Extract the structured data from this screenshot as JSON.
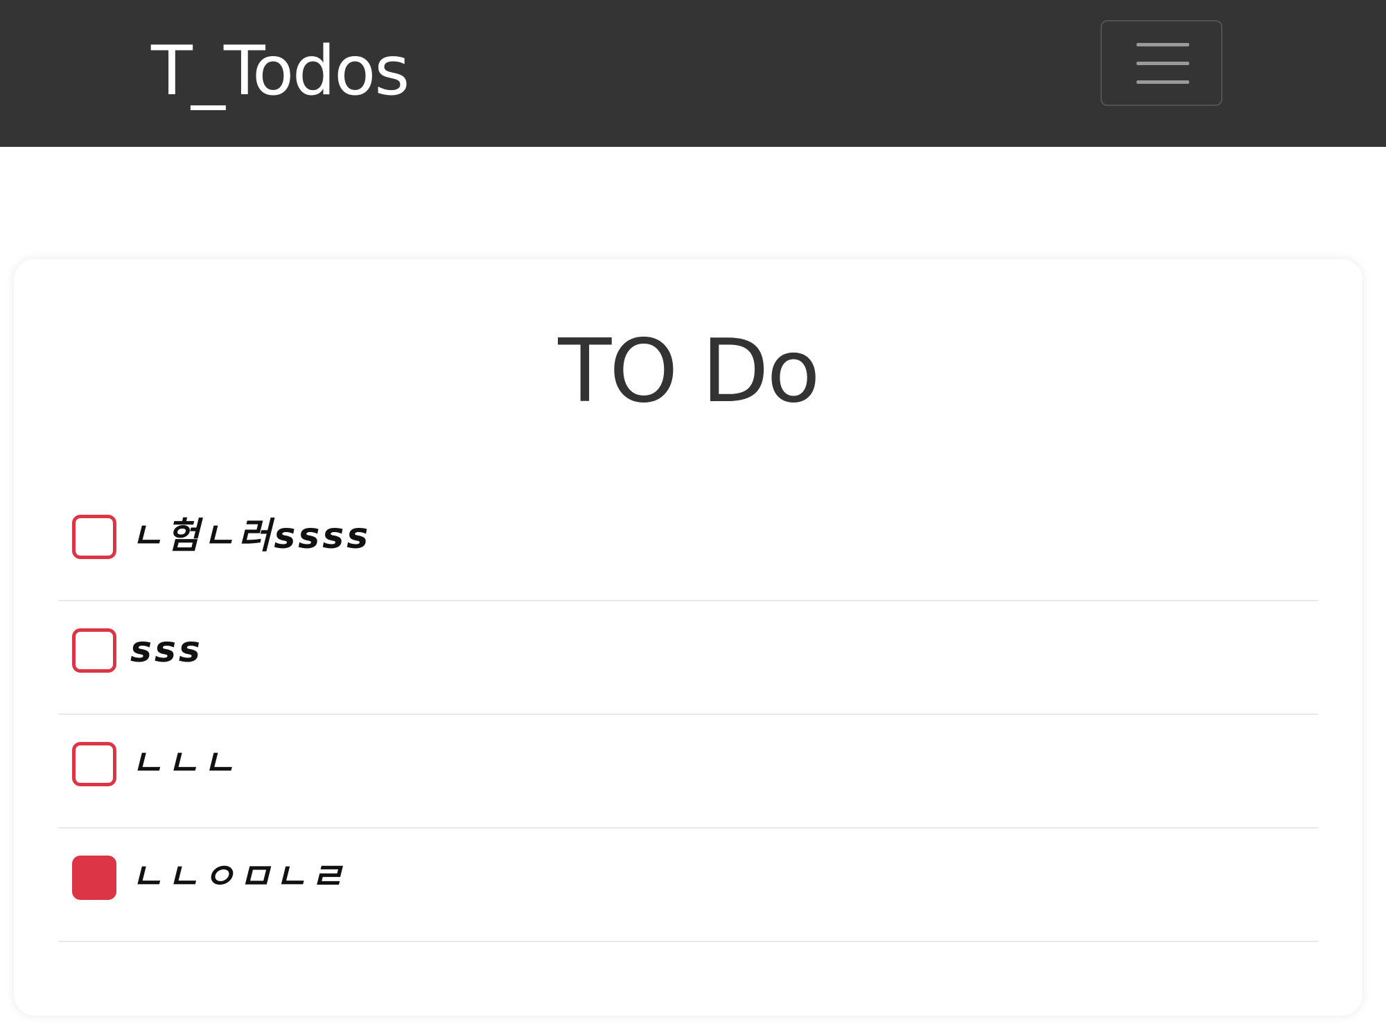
{
  "navbar": {
    "brand": "T_Todos",
    "toggler_icon": "hamburger-menu-icon"
  },
  "card": {
    "title": "TO Do"
  },
  "todos": [
    {
      "text": "ㄴ험ㄴ러ssss",
      "checked": false
    },
    {
      "text": "sss",
      "checked": false
    },
    {
      "text": "ㄴㄴㄴ",
      "checked": false
    },
    {
      "text": "ㄴㄴㅇㅁㄴㄹ",
      "checked": true
    }
  ],
  "colors": {
    "navbar_bg": "#343434",
    "checkbox_accent": "#dc3545",
    "title_text": "#333333"
  }
}
